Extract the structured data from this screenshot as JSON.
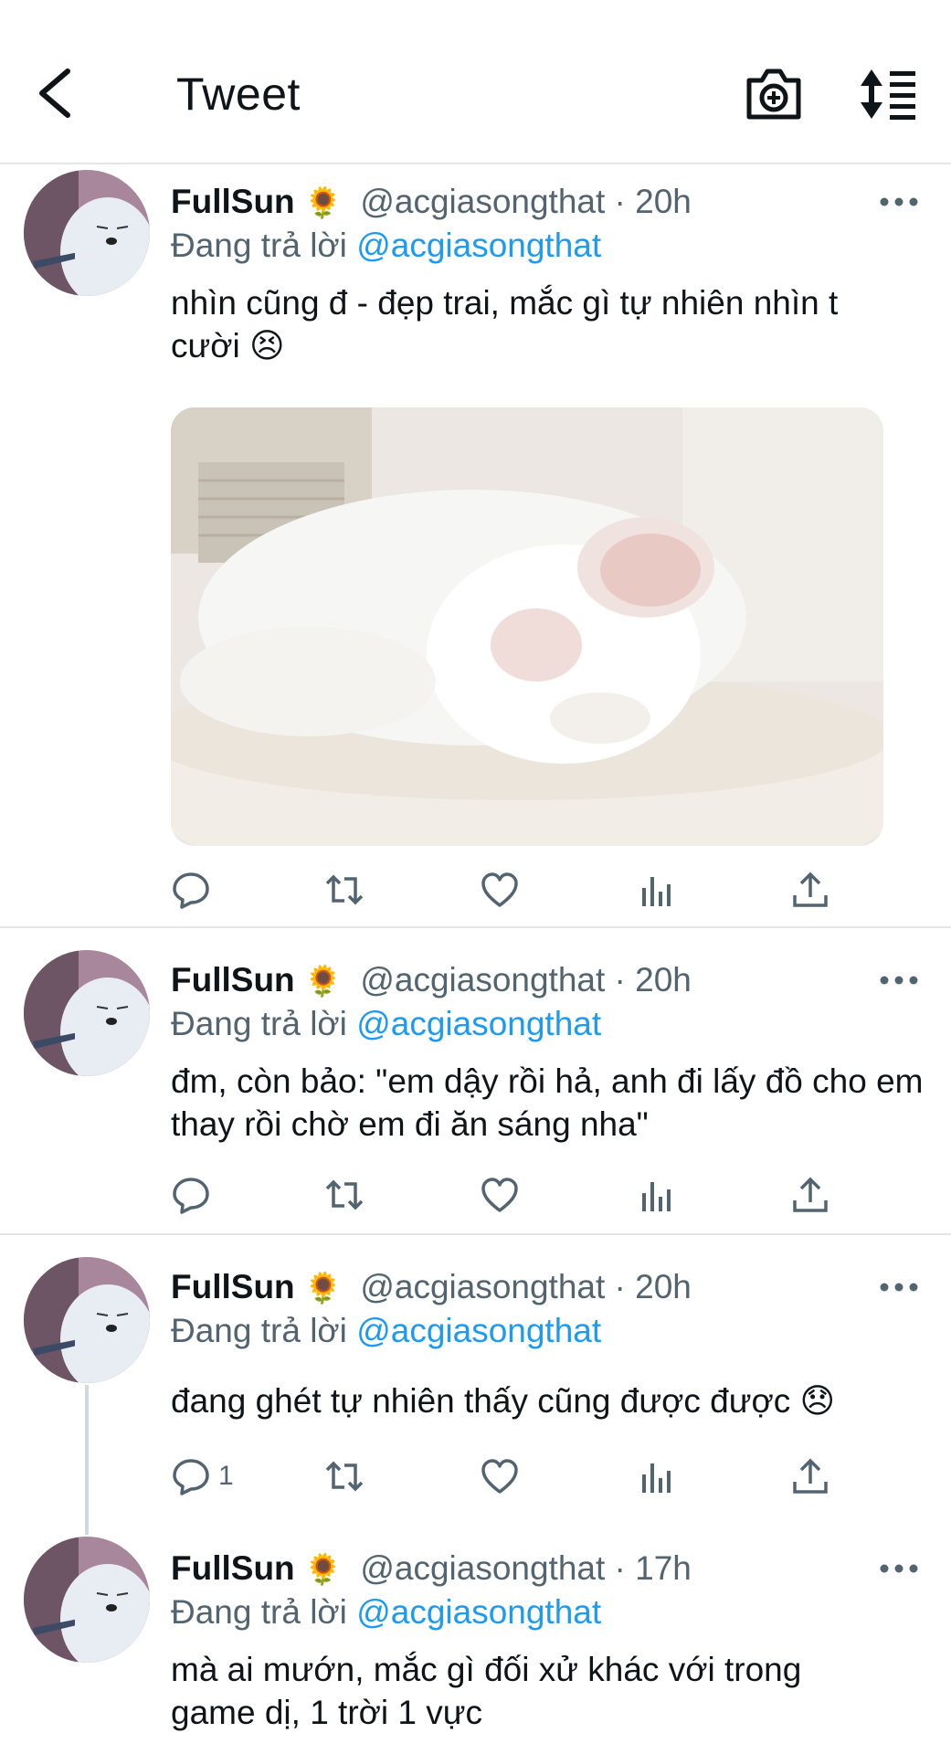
{
  "header": {
    "title": "Tweet",
    "back_icon": "chevron-left-icon",
    "camera_icon": "camera-plus-icon",
    "sort_icon": "sort-list-icon"
  },
  "tweets": [
    {
      "name": "FullSun",
      "badge": "🌻",
      "handle_time": "@acgiasongthat · 20h",
      "reply_prefix": "Đang trả lời",
      "reply_to": "@acgiasongthat",
      "text": "nhìn cũng đ - đẹp trai, mắc gì tự nhiên nhìn t cười 😣",
      "has_media": true,
      "reply_count": ""
    },
    {
      "name": "FullSun",
      "badge": "🌻",
      "handle_time": "@acgiasongthat · 20h",
      "reply_prefix": "Đang trả lời",
      "reply_to": "@acgiasongthat",
      "text": "đm, còn bảo: \"em dậy rồi hả, anh đi lấy đồ cho em thay rồi chờ em đi ăn sáng nha\"",
      "has_media": false,
      "reply_count": ""
    },
    {
      "name": "FullSun",
      "badge": "🌻",
      "handle_time": "@acgiasongthat · 20h",
      "reply_prefix": "Đang trả lời",
      "reply_to": "@acgiasongthat",
      "text": "đang ghét tự nhiên thấy cũng được được 😞",
      "has_media": false,
      "reply_count": "1"
    },
    {
      "name": "FullSun",
      "badge": "🌻",
      "handle_time": "@acgiasongthat · 17h",
      "reply_prefix": "Đang trả lời",
      "reply_to": "@acgiasongthat",
      "text": "mà ai mướn, mắc gì đối xử khác với trong game dị, 1 trời 1 vực",
      "has_media": false,
      "reply_count": ""
    }
  ],
  "action_icons": [
    "reply-icon",
    "retweet-icon",
    "like-icon",
    "views-icon",
    "share-icon"
  ],
  "colors": {
    "accent": "#1d9bf0",
    "secondary_text": "#536471",
    "divider": "#e6e6e6"
  }
}
